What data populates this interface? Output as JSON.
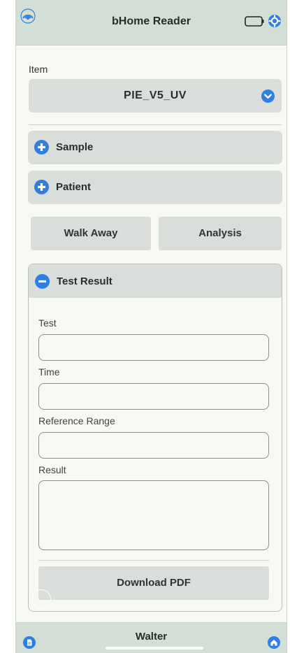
{
  "header": {
    "title": "bHome Reader",
    "icons": [
      "signal-icon",
      "battery-icon",
      "gear-icon"
    ]
  },
  "item": {
    "label": "Item",
    "selected": "PIE_V5_UV"
  },
  "accordions": [
    {
      "label": "Sample",
      "state": "collapsed"
    },
    {
      "label": "Patient",
      "state": "collapsed"
    }
  ],
  "buttons": {
    "walk_away": "Walk Away",
    "analysis": "Analysis"
  },
  "test_result": {
    "label": "Test Result",
    "state": "expanded",
    "fields": [
      {
        "label": "Test",
        "value": ""
      },
      {
        "label": "Time",
        "value": ""
      },
      {
        "label": "Reference Range",
        "value": ""
      },
      {
        "label": "Result",
        "value": ""
      }
    ],
    "download": "Download PDF"
  },
  "footer": {
    "user": "Walter",
    "icons": [
      "document-icon",
      "home-icon"
    ]
  },
  "colors": {
    "accent": "#2f7fe0",
    "bar": "#d3dfd6",
    "panel": "#d9dedb",
    "background": "#f7f7f3"
  }
}
